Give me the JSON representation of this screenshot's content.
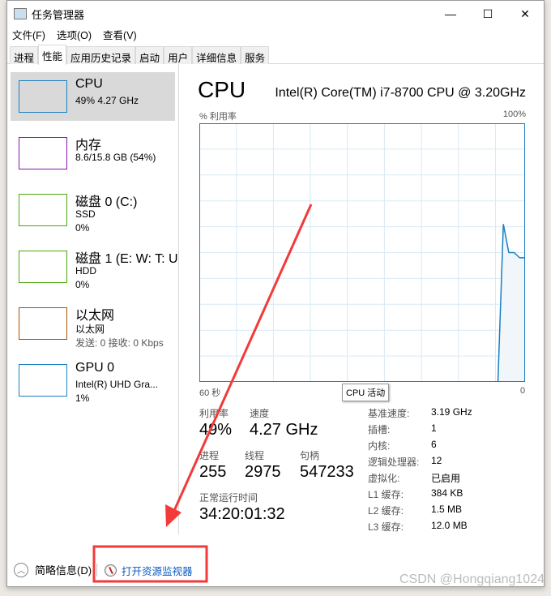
{
  "window": {
    "title": "任务管理器",
    "minimize": "—",
    "maximize": "☐",
    "close": "✕"
  },
  "menu": [
    "文件(F)",
    "选项(O)",
    "查看(V)"
  ],
  "tabs": [
    "进程",
    "性能",
    "应用历史记录",
    "启动",
    "用户",
    "详细信息",
    "服务"
  ],
  "active_tab": "性能",
  "sidebar": [
    {
      "name": "CPU",
      "sub1": "49% 4.27 GHz",
      "sub2": "",
      "color": "#1a7fc1"
    },
    {
      "name": "内存",
      "sub1": "8.6/15.8 GB (54%)",
      "sub2": "",
      "color": "#8b12ae"
    },
    {
      "name": "磁盘 0 (C:)",
      "sub1": "SSD",
      "sub2": "0%",
      "color": "#4da60c"
    },
    {
      "name": "磁盘 1 (E: W: T: U",
      "sub1": "HDD",
      "sub2": "0%",
      "color": "#4da60c"
    },
    {
      "name": "以太网",
      "sub1": "以太网",
      "sub2": "发送: 0 接收: 0 Kbps",
      "color": "#a74f01"
    },
    {
      "name": "GPU 0",
      "sub1": "Intel(R) UHD Gra...",
      "sub2": "1%",
      "color": "#1a7fc1"
    }
  ],
  "main": {
    "title": "CPU",
    "model": "Intel(R) Core(TM) i7-8700 CPU @ 3.20GHz",
    "y_label": "% 利用率",
    "y_max_label": "100%",
    "x_left_label": "60 秒",
    "x_right_label": "0",
    "tooltip": "CPU 活动",
    "stats": {
      "util_label": "利用率",
      "util": "49%",
      "speed_label": "速度",
      "speed": "4.27 GHz",
      "proc_label": "进程",
      "proc": "255",
      "thread_label": "线程",
      "thread": "2975",
      "handle_label": "句柄",
      "handle": "547233",
      "uptime_label": "正常运行时间",
      "uptime": "34:20:01:32"
    },
    "specs": [
      [
        "基准速度:",
        "3.19 GHz"
      ],
      [
        "插槽:",
        "1"
      ],
      [
        "内核:",
        "6"
      ],
      [
        "逻辑处理器:",
        "12"
      ],
      [
        "虚拟化:",
        "已启用"
      ],
      [
        "L1 缓存:",
        "384 KB"
      ],
      [
        "L2 缓存:",
        "1.5 MB"
      ],
      [
        "L3 缓存:",
        "12.0 MB"
      ]
    ]
  },
  "graph": {
    "color": "#1a7fc1",
    "fill": "#f1f6fa",
    "grid": "#d9eaf4",
    "seconds_ago": [
      5,
      4,
      3,
      2,
      1,
      0
    ],
    "percent": [
      0,
      61,
      50,
      50,
      48,
      48
    ]
  },
  "footer": {
    "summary": "简略信息(D)",
    "resource_monitor": "打开资源监视器"
  },
  "watermark": "CSDN @Hongqiang1024"
}
